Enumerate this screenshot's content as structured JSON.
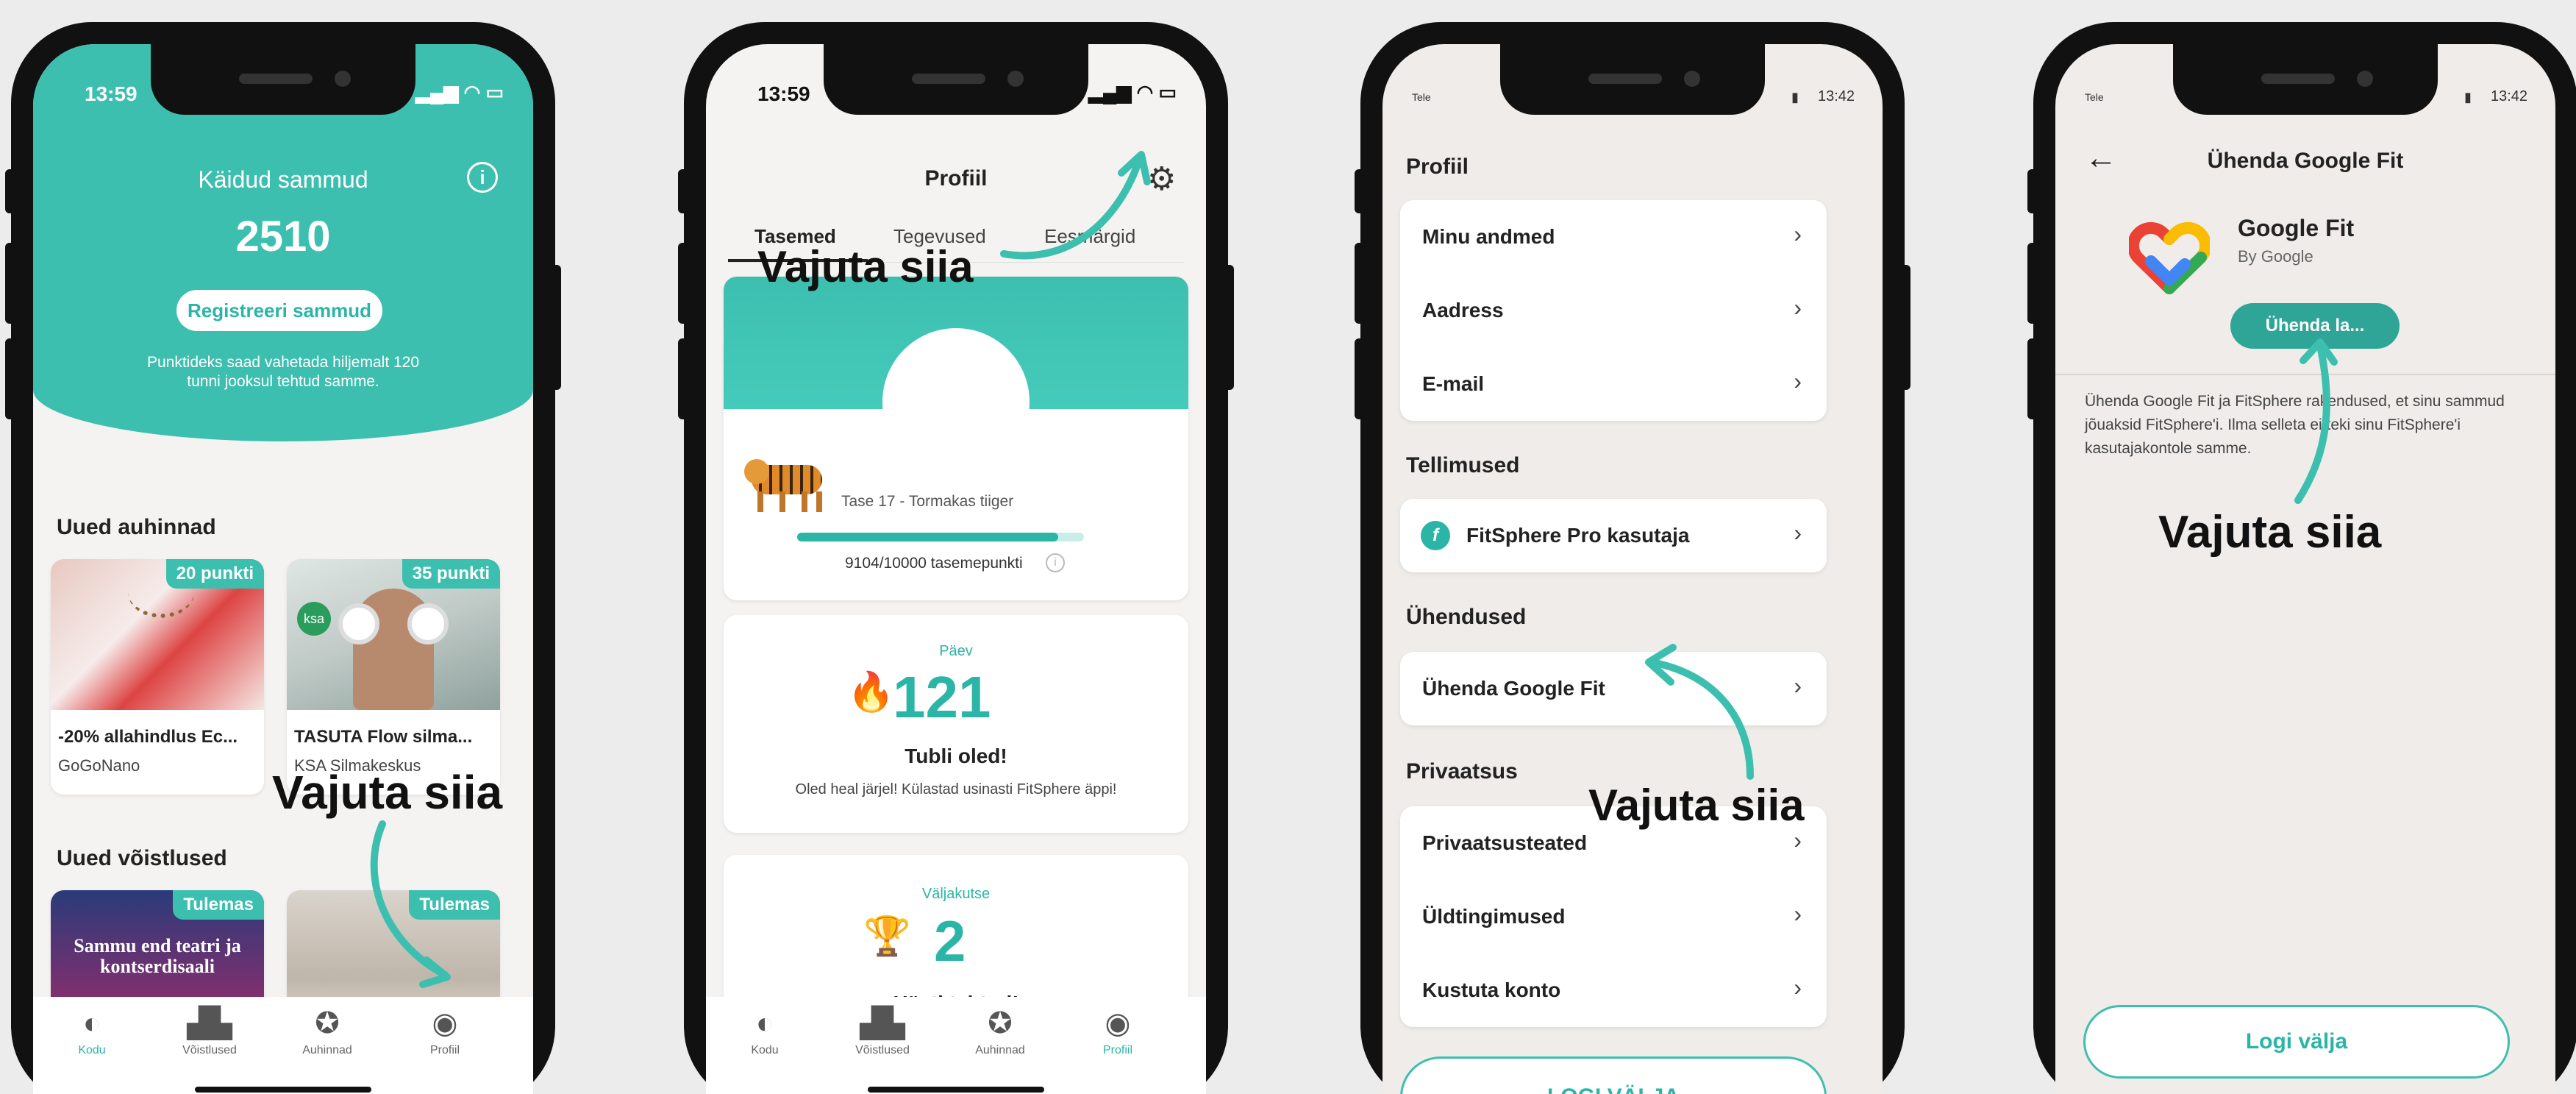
{
  "phone1": {
    "status_time": "13:59",
    "header_title": "Käidud sammud",
    "steps": "2510",
    "register_button": "Registreeri sammud",
    "note": "Punktideks saad vahetada hiljemalt 120 tunni jooksul tehtud samme.",
    "rewards_title": "Uued auhinnad",
    "rewards": [
      {
        "badge": "20 punkti",
        "title": "-20% allahindlus Ec...",
        "vendor": "GoGoNano"
      },
      {
        "badge": "35 punkti",
        "title": "TASUTA Flow silma...",
        "vendor": "KSA Silmakeskus",
        "logo": "ksa"
      }
    ],
    "challenges_title": "Uued võistlused",
    "challenges": [
      {
        "badge": "Tulemas",
        "image_text": "Sammu end teatri ja kontserdisaali"
      },
      {
        "badge": "Tulemas"
      }
    ],
    "callout": "Vajuta siia",
    "nav": [
      "Kodu",
      "Võistlused",
      "Auhinnad",
      "Profiil"
    ]
  },
  "phone2": {
    "status_time": "13:59",
    "title": "Profiil",
    "tabs": [
      "Tasemed",
      "Tegevused",
      "Eesmärgid"
    ],
    "callout": "Vajuta siia",
    "level_text": "Tase 17 - Tormakas tiiger",
    "progress_fraction": 0.9104,
    "progress_text": "9104/10000 tasemepunkti",
    "day_label": "Päev",
    "day_count": "121",
    "day_title": "Tubli oled!",
    "day_sub": "Oled heal järjel! Külastad usinasti FitSphere äppi!",
    "challenge_label": "Väljakutse",
    "challenge_count": "2",
    "challenge_title": "Hästi tehtud!",
    "nav": [
      "Kodu",
      "Võistlused",
      "Auhinnad",
      "Profiil"
    ]
  },
  "phone3": {
    "status_left": "Tele",
    "status_time": "13:42",
    "profile_title": "Profiil",
    "profile_items": [
      "Minu andmed",
      "Aadress",
      "E-mail"
    ],
    "orders_title": "Tellimused",
    "orders_item": "FitSphere Pro kasutaja",
    "connections_title": "Ühendused",
    "connections_item": "Ühenda Google Fit",
    "privacy_title": "Privaatsus",
    "privacy_items": [
      "Privaatsusteated",
      "Üldtingimused",
      "Kustuta konto"
    ],
    "callout": "Vajuta siia",
    "logout": "LOGI VÄLJA"
  },
  "phone4": {
    "status_left": "Tele",
    "status_time": "13:42",
    "title": "Ühenda Google Fit",
    "app_name": "Google Fit",
    "app_by": "By Google",
    "connect_button": "Ühenda la...",
    "description": "Ühenda Google Fit ja FitSphere rakendused, et sinu sammud jõuaksid FitSphere'i. Ilma selleta ei teki sinu FitSphere'i kasutajakontole samme.",
    "callout": "Vajuta siia",
    "logout": "Logi välja"
  }
}
